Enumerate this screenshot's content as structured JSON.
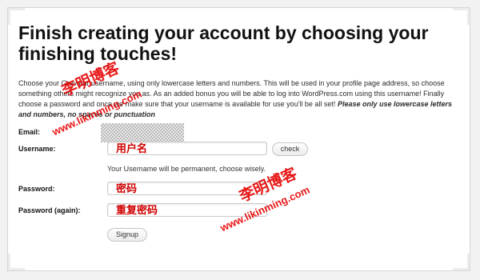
{
  "heading": "Finish creating your account by choosing your finishing touches!",
  "intro": {
    "text": "Choose your Gravatar username, using only lowercase letters and numbers. This will be used in your profile page address, so choose something others might recognize you as. As an added bonus you will be able to log into WordPress.com using this username! Finally choose a password and once we make sure that your username is available for use you'll be all set! ",
    "emphasis": "Please only use lowercase letters and numbers, no spaces or punctuation"
  },
  "form": {
    "email_label": "Email:",
    "username_label": "Username:",
    "username_value": "用户名",
    "check_label": "check",
    "username_hint": "Your Username will be permanent, choose wisely.",
    "password_label": "Password:",
    "password_value": "密码",
    "password_again_label": "Password (again):",
    "password_again_value": "重复密码",
    "signup_label": "Signup"
  },
  "watermarks": {
    "blog_name_a": "李明博客",
    "url_a": "www.likinming.com",
    "blog_name_b": "李明博客",
    "url_b": "www.likinming.com"
  }
}
